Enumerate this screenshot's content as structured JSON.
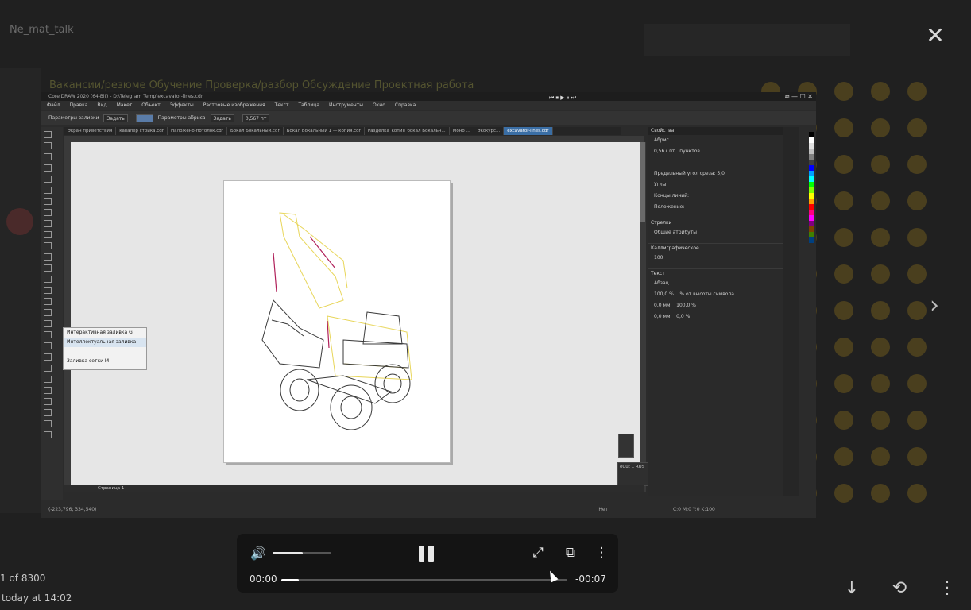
{
  "background_chat": {
    "title": "Ne_mat_talk",
    "links": "Вакансии/резюме  Обучение  Проверка/разбор   Обсуждение  Проектная работа",
    "emoji_count": 60
  },
  "viewer": {
    "counter": "1 of 8300",
    "date": "today at 14:02",
    "close_label": "✕",
    "next_label": "›",
    "bottom_icons": [
      "↓",
      "⟲",
      "⋮"
    ]
  },
  "coreldraw": {
    "title": "CorelDRAW 2020 (64-Bit) - D:\\Telegram Temp\\excavator-lines.cdr",
    "menu": [
      "Файл",
      "Правка",
      "Вид",
      "Макет",
      "Объект",
      "Эффекты",
      "Растровые изображения",
      "Текст",
      "Таблица",
      "Инструменты",
      "Окно",
      "Справка"
    ],
    "prop_fill_label": "Параметры заливки",
    "prop_fill_value": "Задать",
    "prop_outline_label": "Параметры абриса",
    "prop_outline_value": "Задать",
    "prop_width": "0,567 пт",
    "tabs": [
      "Экран приветствия",
      "кавалер стойка.cdr",
      "Наложено-потолок.cdr",
      "Бокал Бокальный.cdr",
      "Бокал Бокальный 1 — копия.cdr",
      "Разделка_копия_бокал Бокальн...",
      "Моно ...",
      "Экскурс...",
      "excavator-lines.cdr"
    ],
    "flyout": [
      "Интерактивная заливка",
      "Интеллектуальная заливка",
      "",
      "Заливка сетки"
    ],
    "flyout_keys": [
      "G",
      "",
      "",
      "M"
    ],
    "panel_title": "Свойства",
    "panel_rows": {
      "outline_title": "Абрис",
      "width": "0,567 пт",
      "units": "пунктов",
      "miter": "Предельный угол среза:",
      "miter_value": "5,0",
      "corners": "Углы:",
      "line_caps": "Концы линий:",
      "position": "Положение:",
      "arrows": "Стрелки",
      "shared": "Общие атрибуты",
      "calligraphic": "Каллиграфическое",
      "calligraphic_value": "100",
      "text": "Текст",
      "paragraph": "Абзац",
      "para_1": "100,0 %",
      "para_2": "% от высоты символа",
      "para_3": "0,0 мм",
      "para_4": "100,0 %",
      "para_5": "0,0 %"
    },
    "page_tab": "Страница 1",
    "status_coords": "(-223,796; 334,540)",
    "status_fill": "Нет",
    "status_color": "C:0 M:0 Y:0 K:100",
    "ecut_label": "eCut 1 RUS",
    "palette": [
      "#000000",
      "#ffffff",
      "#e0e0e0",
      "#c0c0c0",
      "#808080",
      "#404040",
      "#0000ff",
      "#00a0ff",
      "#00ffff",
      "#00ff00",
      "#80ff00",
      "#ffff00",
      "#ffa000",
      "#ff0000",
      "#ff0080",
      "#ff00ff",
      "#800080",
      "#804000",
      "#408000",
      "#004080"
    ]
  },
  "player": {
    "current_time": "00:00",
    "remaining_time": "-00:07",
    "volume_level": 0.52,
    "progress": 0.06,
    "volume_icon": "🔊",
    "fullscreen_icon": "⤢",
    "pip_icon": "⧉",
    "more_icon": "⋮"
  }
}
